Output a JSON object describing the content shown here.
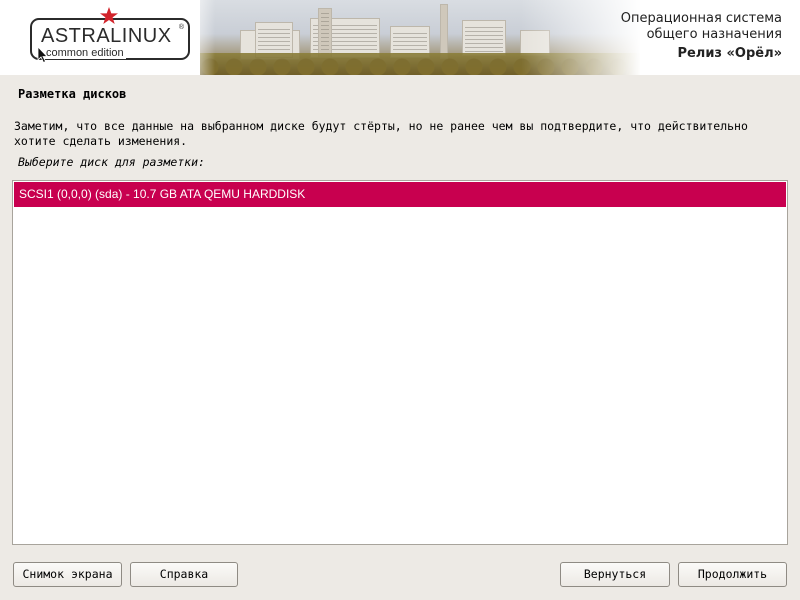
{
  "header": {
    "logo_text": "ASTRALINUX",
    "logo_registered": "®",
    "logo_subtitle": "common edition",
    "os_title_line1": "Операционная система",
    "os_title_line2": "общего назначения",
    "release": "Релиз «Орёл»",
    "accent_color": "#d2232a"
  },
  "main": {
    "page_title": "Разметка дисков",
    "description": "Заметим, что все данные на выбранном диске будут стёрты, но не ранее чем вы подтвердите, что действительно хотите сделать изменения.",
    "prompt": "Выберите диск для разметки:",
    "disks": [
      {
        "label": "SCSI1 (0,0,0) (sda) - 10.7 GB ATA QEMU HARDDISK",
        "selected": true
      }
    ],
    "selection_color": "#c8004f"
  },
  "footer": {
    "screenshot_label": "Снимок экрана",
    "help_label": "Справка",
    "back_label": "Вернуться",
    "continue_label": "Продолжить"
  },
  "icons": [
    "red-star-icon",
    "mouse-cursor-icon"
  ]
}
